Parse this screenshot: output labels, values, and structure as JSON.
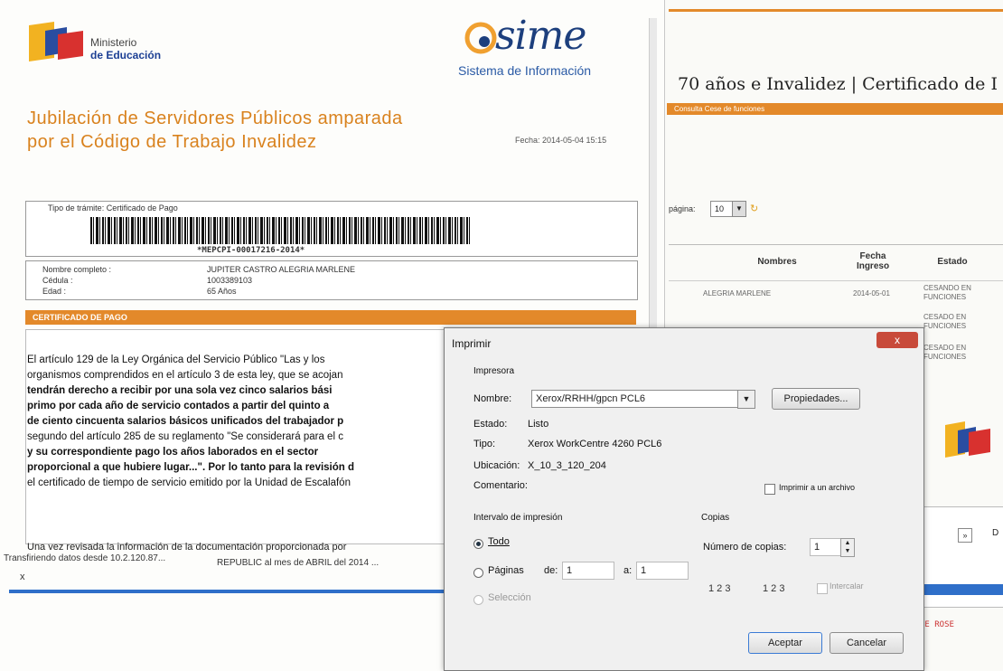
{
  "left_doc": {
    "ministry": {
      "line1": "Ministerio",
      "line2": "de Educación"
    },
    "logo": {
      "word": "sime",
      "subtitle": "Sistema de Información"
    },
    "title": "Jubilación de Servidores Públicos amparada por el Código de Trabajo Invalidez",
    "fecha": "Fecha: 2014-05-04 15:15",
    "tramite_label": "Tipo de trámite: Certificado de Pago",
    "barcode_text": "*MEPCPI-00017216-2014*",
    "fields": [
      {
        "label": "Nombre completo :",
        "value": "JUPITER CASTRO ALEGRIA MARLENE"
      },
      {
        "label": "Cédula :",
        "value": "1003389103"
      },
      {
        "label": "Edad :",
        "value": "65 Años"
      }
    ],
    "section_header": "CERTIFICADO DE PAGO",
    "body_lines": [
      "El artículo 129 de la Ley Orgánica del Servicio Público \"Las y los",
      "organismos comprendidos en el artículo 3 de esta ley, que se acojan",
      "tendrán derecho a recibir por una sola vez cinco salarios bási",
      "primo por cada año de servicio contados a partir del quinto a",
      "de ciento cincuenta salarios básicos unificados del trabajador p",
      "segundo del artículo 285 de su reglamento \"Se considerará para el c",
      "y su correspondiente pago los años laborados en el sector",
      "proporcional a que hubiere lugar...\". Por lo tanto para la revisión d",
      "el certificado de tiempo de servicio emitido por la Unidad de Escalafón"
    ],
    "trailing_text": "Una vez revisada la información de la documentación proporcionada por",
    "trailing_text2": "REPUBLIC al mes de ABRIL del 2014 ...",
    "status_line": "Transfiriendo datos desde 10.2.120.87...",
    "close_x": "x"
  },
  "right_win": {
    "title": "70 años e Invalidez | Certificado de I",
    "orange_bar": "Consulta Cese de funciones",
    "pager_label": "página:",
    "pager_value": "10",
    "columns": [
      "Nombres",
      "Fecha Ingreso",
      "Estado"
    ],
    "rows": [
      {
        "nombre": "ALEGRIA MARLENE",
        "fecha": "2014-05-01",
        "estado": "CESANDO EN FUNCIONES"
      },
      {
        "nombre": "",
        "fecha": "",
        "estado": "CESADO EN FUNCIONES"
      },
      {
        "nombre": "",
        "fecha": "",
        "estado": "CESADO EN FUNCIONES"
      }
    ],
    "second_panel_label": "D",
    "red_text": "NE ROSE"
  },
  "dialog": {
    "title": "Imprimir",
    "close": "x",
    "group_printer": "Impresora",
    "name_label": "Nombre:",
    "name_value": "Xerox/RRHH/gpcn PCL6",
    "properties_btn": "Propiedades...",
    "estado_label": "Estado:",
    "estado_value": "Listo",
    "tipo_label": "Tipo:",
    "tipo_value": "Xerox WorkCentre 4260 PCL6",
    "ubicacion_label": "Ubicación:",
    "ubicacion_value": "X_10_3_120_204",
    "comentario_label": "Comentario:",
    "print_to_file": "Imprimir a un archivo",
    "range_group": "Intervalo de impresión",
    "range_all": "Todo",
    "range_pages": "Páginas",
    "range_from": "de:",
    "range_from_value": "1",
    "range_to": "a:",
    "range_to_value": "1",
    "range_selection": "Selección",
    "copies_group": "Copias",
    "copies_label": "Número de copias:",
    "copies_value": "1",
    "collate_label": "Intercalar",
    "collate_glyph_a": "1 2 3",
    "collate_glyph_b": "1 2 3",
    "ok_btn": "Aceptar",
    "cancel_btn": "Cancelar"
  },
  "colors": {
    "orange": "#e3892a",
    "blue": "#2f6fc9",
    "title_orange": "#d9821e"
  }
}
